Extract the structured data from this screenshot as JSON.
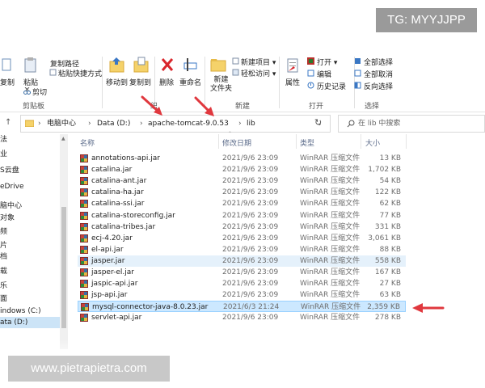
{
  "watermark_top": "TG: MYYJJPP",
  "watermark_bottom": "www.pietrapietra.com",
  "ribbon": {
    "clipboard": {
      "copy_path": "复制路径",
      "paste_shortcut": "粘贴快捷方式",
      "cut": "剪切",
      "copy": "复制",
      "paste": "粘贴",
      "group": "剪贴板"
    },
    "organize": {
      "move_to": "移动到",
      "copy_to": "复制到",
      "delete": "删除",
      "rename": "重命名",
      "group": "织"
    },
    "new": {
      "new_item": "新建项目",
      "easy_access": "轻松访问",
      "new_folder_line1": "新建",
      "new_folder_line2": "文件夹",
      "group": "新建"
    },
    "open": {
      "properties": "属性",
      "open": "打开",
      "edit": "编辑",
      "history": "历史记录",
      "group": "打开"
    },
    "select": {
      "select_all": "全部选择",
      "select_none": "全部取消",
      "invert": "反向选择",
      "group": "选择"
    }
  },
  "address": {
    "crumbs": [
      "电脑中心",
      "Data (D:)",
      "apache-tomcat-9.0.53",
      "lib"
    ],
    "search_placeholder": "在 lib 中搜索"
  },
  "nav": {
    "items": [
      "法",
      "业",
      "S云盘",
      "eDrive",
      "脑中心",
      "对象",
      "频",
      "片",
      "档",
      "载",
      "乐",
      "面",
      "indows (C:)",
      "ata (D:)"
    ],
    "selected_index": 13
  },
  "columns": {
    "name": "名称",
    "date": "修改日期",
    "type": "类型",
    "size": "大小"
  },
  "files": [
    {
      "name": "annotations-api.jar",
      "date": "2021/9/6 23:09",
      "type": "WinRAR 压缩文件",
      "size": "13 KB"
    },
    {
      "name": "catalina.jar",
      "date": "2021/9/6 23:09",
      "type": "WinRAR 压缩文件",
      "size": "1,702 KB"
    },
    {
      "name": "catalina-ant.jar",
      "date": "2021/9/6 23:09",
      "type": "WinRAR 压缩文件",
      "size": "54 KB"
    },
    {
      "name": "catalina-ha.jar",
      "date": "2021/9/6 23:09",
      "type": "WinRAR 压缩文件",
      "size": "122 KB"
    },
    {
      "name": "catalina-ssi.jar",
      "date": "2021/9/6 23:09",
      "type": "WinRAR 压缩文件",
      "size": "62 KB"
    },
    {
      "name": "catalina-storeconfig.jar",
      "date": "2021/9/6 23:09",
      "type": "WinRAR 压缩文件",
      "size": "77 KB"
    },
    {
      "name": "catalina-tribes.jar",
      "date": "2021/9/6 23:09",
      "type": "WinRAR 压缩文件",
      "size": "331 KB"
    },
    {
      "name": "ecj-4.20.jar",
      "date": "2021/9/6 23:09",
      "type": "WinRAR 压缩文件",
      "size": "3,061 KB"
    },
    {
      "name": "el-api.jar",
      "date": "2021/9/6 23:09",
      "type": "WinRAR 压缩文件",
      "size": "88 KB"
    },
    {
      "name": "jasper.jar",
      "date": "2021/9/6 23:09",
      "type": "WinRAR 压缩文件",
      "size": "558 KB"
    },
    {
      "name": "jasper-el.jar",
      "date": "2021/9/6 23:09",
      "type": "WinRAR 压缩文件",
      "size": "167 KB"
    },
    {
      "name": "jaspic-api.jar",
      "date": "2021/9/6 23:09",
      "type": "WinRAR 压缩文件",
      "size": "27 KB"
    },
    {
      "name": "jsp-api.jar",
      "date": "2021/9/6 23:09",
      "type": "WinRAR 压缩文件",
      "size": "63 KB"
    },
    {
      "name": "mysql-connector-java-8.0.23.jar",
      "date": "2021/6/3 21:24",
      "type": "WinRAR 压缩文件",
      "size": "2,359 KB"
    },
    {
      "name": "servlet-api.jar",
      "date": "2021/9/6 23:09",
      "type": "WinRAR 压缩文件",
      "size": "278 KB"
    }
  ],
  "hover_row": 9,
  "selected_row": 13,
  "colors": {
    "accent_arrow": "#e0383e",
    "selection": "#cce8ff",
    "hover": "#e5f1fb"
  }
}
